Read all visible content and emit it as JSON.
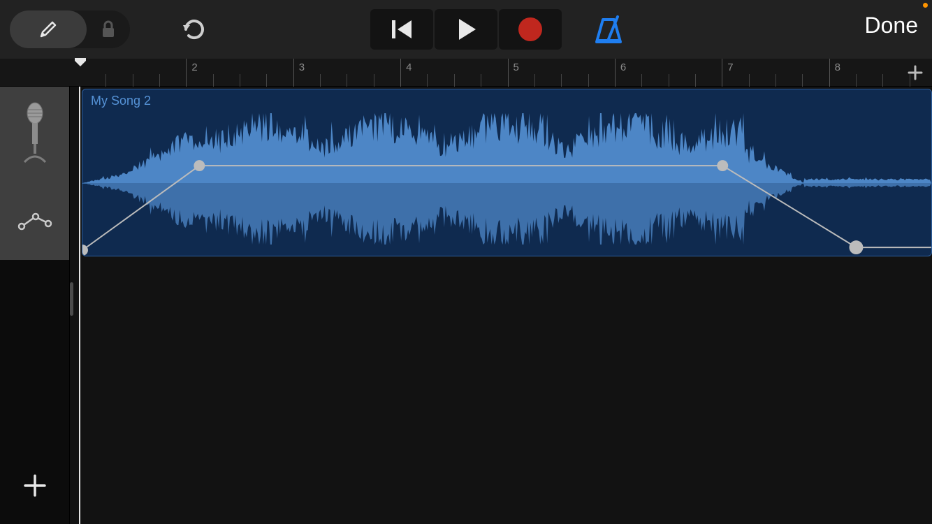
{
  "toolbar": {
    "done_label": "Done"
  },
  "ruler": {
    "bars": [
      "2",
      "3",
      "4",
      "5",
      "6",
      "7",
      "8"
    ]
  },
  "region": {
    "label": "My Song 2"
  },
  "icons": {
    "pencil": "pencil-icon",
    "lock": "lock-icon",
    "undo": "undo-icon",
    "rewind": "rewind-icon",
    "play": "play-icon",
    "record": "record-icon",
    "metronome": "metronome-icon",
    "mic": "microphone-icon",
    "automation": "automation-icon",
    "plus": "plus-icon"
  }
}
